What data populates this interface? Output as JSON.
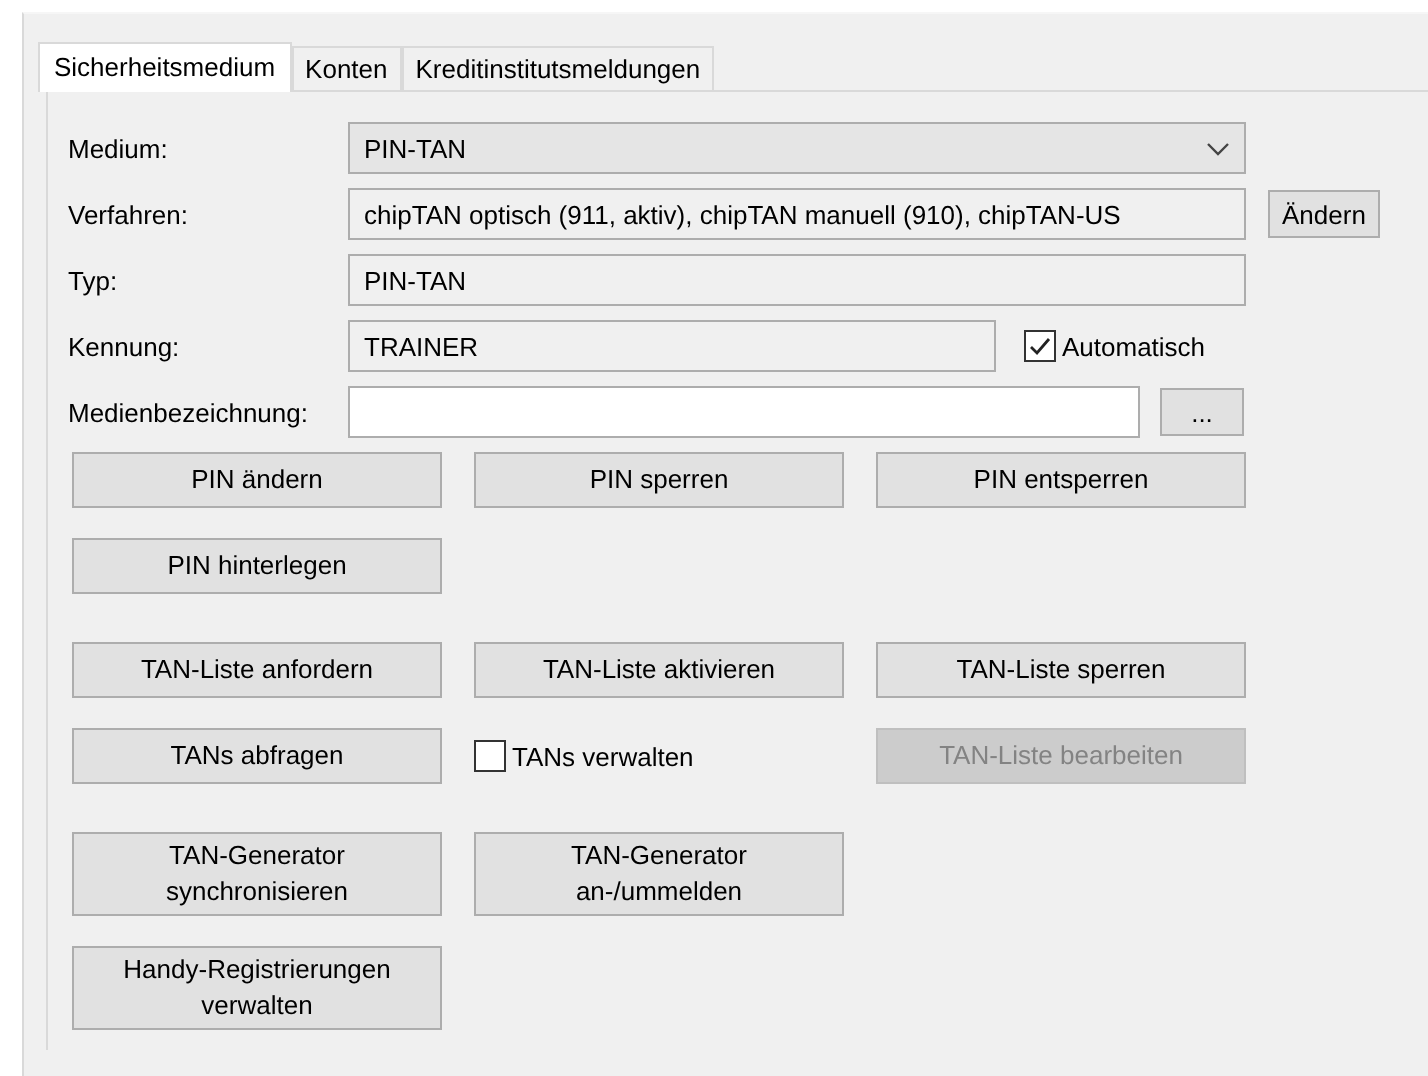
{
  "tabs": [
    {
      "label": "Sicherheitsmedium",
      "selected": true
    },
    {
      "label": "Konten",
      "selected": false
    },
    {
      "label": "Kreditinstitutsmeldungen",
      "selected": false
    }
  ],
  "fields": [
    {
      "kind": "dropdown",
      "label": "Medium:",
      "value": "PIN-TAN"
    },
    {
      "kind": "text",
      "label": "Verfahren:",
      "value": "chipTAN optisch (911, aktiv), chipTAN manuell (910), chipTAN-US",
      "readonly": true,
      "button": "Ändern"
    },
    {
      "kind": "text",
      "label": "Typ:",
      "value": "PIN-TAN",
      "readonly": true
    },
    {
      "kind": "text",
      "label": "Kennung:",
      "value": "TRAINER",
      "readonly": true,
      "checkbox": {
        "label": "Automatisch",
        "checked": true
      }
    },
    {
      "kind": "text",
      "label": "Medienbezeichnung:",
      "readonly": false,
      "button": "..."
    }
  ],
  "button_groups": [
    [
      [
        {
          "kind": "button",
          "label": "PIN ändern",
          "disabled": false
        },
        {
          "kind": "button",
          "label": "PIN sperren",
          "disabled": false
        },
        {
          "kind": "button",
          "label": "PIN entsperren",
          "disabled": false
        }
      ],
      [
        {
          "kind": "button",
          "label": "PIN hinterlegen",
          "disabled": false
        }
      ]
    ],
    [
      [
        {
          "kind": "button",
          "label": "TAN-Liste anfordern",
          "disabled": false
        },
        {
          "kind": "button",
          "label": "TAN-Liste aktivieren",
          "disabled": false
        },
        {
          "kind": "button",
          "label": "TAN-Liste sperren",
          "disabled": false
        }
      ],
      [
        {
          "kind": "button",
          "label": "TANs abfragen",
          "disabled": false
        },
        {
          "kind": "checkbox",
          "label": "TANs verwalten",
          "checked": false
        },
        {
          "kind": "button",
          "label": "TAN-Liste bearbeiten",
          "disabled": true
        }
      ]
    ],
    [
      [
        {
          "kind": "button",
          "label": "TAN-Generator\nsynchronisieren",
          "disabled": false
        },
        {
          "kind": "button",
          "label": "TAN-Generator\nan-/ummelden",
          "disabled": false
        }
      ],
      [
        {
          "kind": "button",
          "label": "Handy-Registrierungen\nverwalten",
          "disabled": false
        }
      ]
    ]
  ]
}
